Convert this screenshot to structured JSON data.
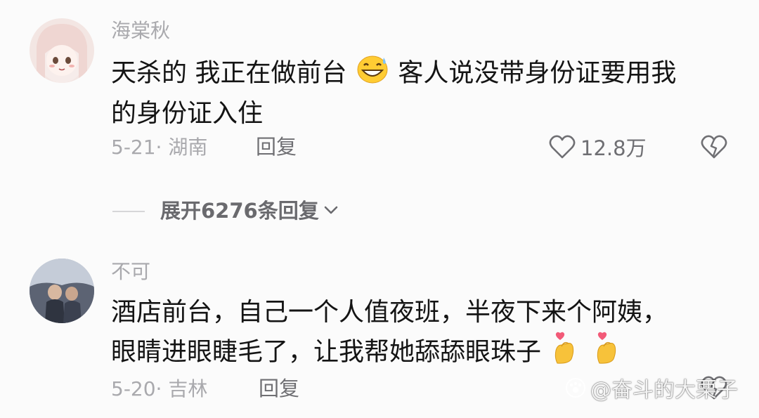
{
  "comments": [
    {
      "username": "海棠秋",
      "content_line1_a": "天杀的 我正在做前台",
      "content_line1_emoji": "grinning-sweat-emoji",
      "content_line1_b": "客人说没带身份证要用我",
      "content_line2": "的身份证入住",
      "date_location": "5-21· 湖南",
      "reply_label": "回复",
      "likes": "12.8万"
    },
    {
      "username": "不可",
      "content_line1": "酒店前台，自己一个人值夜班，半夜下来个阿姨，",
      "content_line2": "眼睛进眼睫毛了，让我帮她舔舔眼珠子",
      "content_emoji": "finger-heart-emoji",
      "date_location": "5-20· 吉林",
      "reply_label": "回复"
    }
  ],
  "expand_replies": {
    "label": "展开6276条回复"
  },
  "watermark": {
    "text": "@奋斗的大栗子"
  },
  "colors": {
    "background": "#fbfbfb",
    "text_primary": "#141414",
    "text_secondary": "#a9a9ad",
    "text_action": "#6f6f73"
  }
}
